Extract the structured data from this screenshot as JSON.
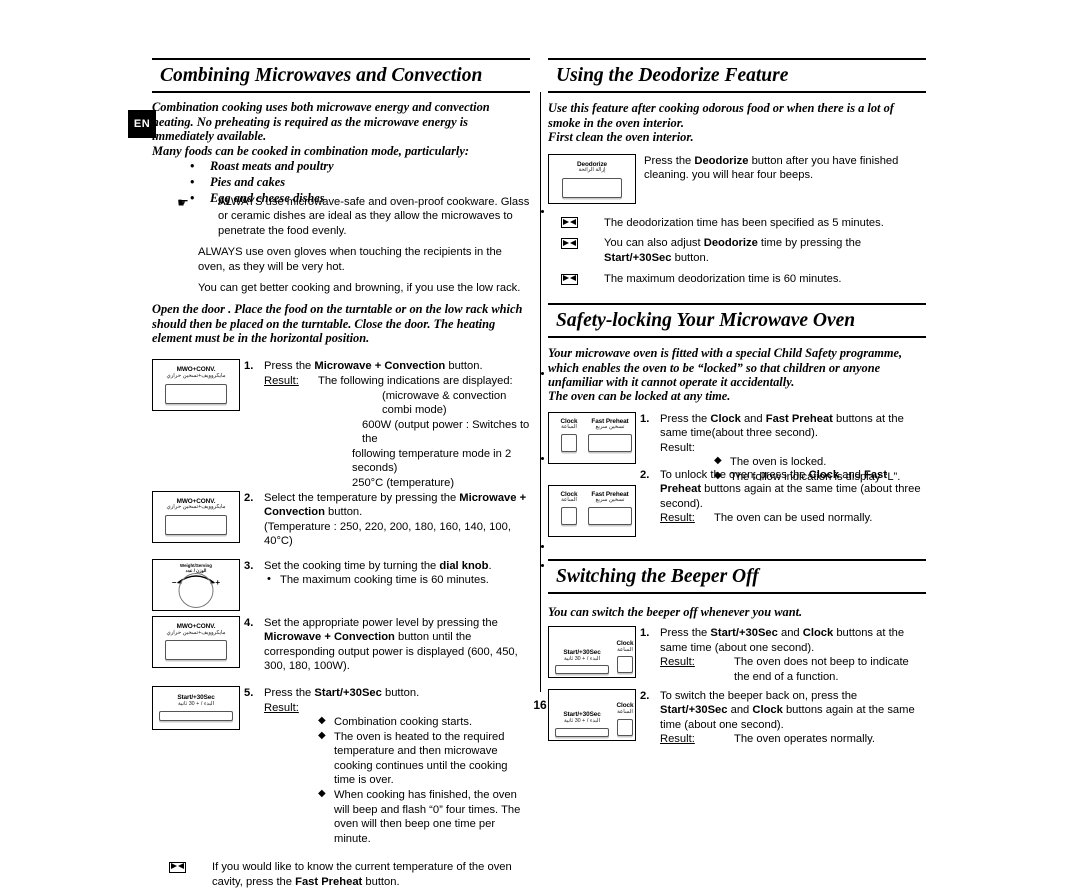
{
  "page": {
    "number": "16",
    "language_tab": "EN"
  },
  "left_column": {
    "heading": "Combining Microwaves and Convection",
    "intro": "Combination cooking uses both microwave energy and convection heating. No preheating is required as the microwave energy is immediately available.",
    "intro2": "Many foods can be cooked in combination mode, particularly:",
    "food_bullets": [
      "Roast meats and poultry",
      "Pies and cakes",
      "Egg and cheese dishes"
    ],
    "notes": [
      "ALWAYS use microwave-safe and oven-proof cookware. Glass or ceramic dishes are ideal as they allow the microwaves to penetrate the food evenly.",
      "ALWAYS use oven gloves when touching the recipients in the oven, as they will be very hot.",
      "You can get better cooking and browning, if you use the low rack."
    ],
    "door_note": "Open the door . Place the food on the turntable or on the low rack which should then be placed on the turntable. Close the door. The heating element must be in the horizontal position.",
    "steps": [
      {
        "num": "1.",
        "panel": "mwo-conv",
        "text_pre": "Press the ",
        "text_bold": "Microwave + Convection",
        "text_post": " button.",
        "result_label": "Result:",
        "result_text": "The following indications are displayed:",
        "result_lines": [
          "(microwave & convection combi mode)",
          "600W    (output power : Switches to the",
          "following temperature mode in 2 seconds)",
          "250°C   (temperature)"
        ]
      },
      {
        "num": "2.",
        "panel": "mwo-conv",
        "text_pre": "Select the temperature by pressing the ",
        "text_bold": "Microwave + Convection",
        "text_post": " button.",
        "extra": "(Temperature : 250, 220, 200, 180, 160, 140, 100, 40°C)"
      },
      {
        "num": "3.",
        "panel": "dial",
        "text_pre": "Set the cooking time by turning the ",
        "text_bold": "dial knob",
        "text_post": ".",
        "bullets": [
          "The maximum cooking time is 60 minutes."
        ]
      },
      {
        "num": "4.",
        "panel": "mwo-conv",
        "text_pre": "Set the appropriate power level by pressing the ",
        "text_bold": "Microwave + Convection",
        "text_post": " button until the corresponding output power is displayed (600, 450, 300, 180, 100W)."
      },
      {
        "num": "5.",
        "panel": "start30",
        "text_pre": "Press the ",
        "text_bold": "Start/+30Sec",
        "text_post": " button.",
        "result_label": "Result:",
        "diamonds": [
          "Combination cooking starts.",
          "The oven is heated to the required temperature and then microwave cooking continues until the cooking time is over.",
          "When cooking has finished, the oven will beep and flash “0” four times. The oven will then beep one time per minute."
        ]
      }
    ],
    "final_note_pre": "If you would like to know the current temperature of the oven cavity, press the ",
    "final_note_bold": "Fast Preheat",
    "final_note_post": " button."
  },
  "right_column": {
    "deodorize": {
      "heading": "Using the Deodorize Feature",
      "lead1": "Use this feature after cooking odorous food or when there is a lot of smoke in the oven interior.",
      "lead2": "First clean the oven interior.",
      "panel_label": "Deodorize",
      "panel_label_ar": "إزالة الرائحة",
      "instruction_pre": "Press the ",
      "instruction_bold": "Deodorize",
      "instruction_post": " button after you have finished cleaning. you will hear four beeps.",
      "notes": [
        {
          "pre": "The deodorization time has been specified as 5 minutes.",
          "bold": "",
          "post": ""
        },
        {
          "pre": "You can also adjust ",
          "bold": "Deodorize",
          "mid": " time by pressing the ",
          "bold2": "Start/+30Sec",
          "post": " button."
        },
        {
          "pre": "The maximum deodorization time is 60 minutes.",
          "bold": "",
          "post": ""
        }
      ]
    },
    "safety_lock": {
      "heading": "Safety-locking Your Microwave Oven",
      "lead1": "Your microwave oven is fitted with a special Child Safety programme, which enables the oven to be “locked” so that children or anyone unfamiliar with it cannot operate it accidentally.",
      "lead2": "The oven can be locked at any time.",
      "steps": [
        {
          "num": "1.",
          "text_pre": "Press the ",
          "text_bold": "Clock",
          "text_mid": " and ",
          "text_bold2": "Fast Preheat",
          "text_post": " buttons at the same time(about three second).",
          "result_label": "Result:",
          "diamonds": [
            "The oven is locked.",
            "The follow indication is display “L”."
          ]
        },
        {
          "num": "2.",
          "text_pre": "To unlock the oven, press the ",
          "text_bold": "Clock",
          "text_mid": " and ",
          "text_bold2": "Fast Preheat",
          "text_post": " buttons again at the same time (about three second).",
          "result_label": "Result:",
          "result_text": "The oven can be used normally."
        }
      ]
    },
    "beeper": {
      "heading": "Switching the Beeper Off",
      "lead": "You can switch the beeper off whenever you want.",
      "steps": [
        {
          "num": "1.",
          "text_pre": "Press the ",
          "text_bold": "Start/+30Sec",
          "text_mid": " and ",
          "text_bold2": "Clock",
          "text_post": " buttons at the same time (about one second).",
          "result_label": "Result:",
          "result_text": "The oven does not beep to indicate the end of a function."
        },
        {
          "num": "2.",
          "text_pre": "To switch the beeper back on, press the ",
          "text_bold": "Start/+30Sec",
          "text_mid": " and ",
          "text_bold2": "Clock",
          "text_post": " buttons again at the same time (about one second).",
          "result_label": "Result:",
          "result_text": "The oven operates normally."
        }
      ]
    }
  },
  "panel_labels": {
    "mwo_conv": "MWO+CONV.",
    "mwo_conv_ar": "مايكروويف+تسخين حراري",
    "dial_top": "Weight/Serving",
    "dial_top_ar": "الوزن / عدد",
    "minus": "–",
    "plus": "+",
    "start30": "Start/+30Sec",
    "start30_ar": "البدء / + 30 ثانية",
    "deodorize": "Deodorize",
    "deodorize_ar": "إزالة الرائحة",
    "clock": "Clock",
    "clock_ar": "الساعة",
    "fast_preheat": "Fast Preheat",
    "fast_preheat_ar": "تسخين سريع"
  }
}
